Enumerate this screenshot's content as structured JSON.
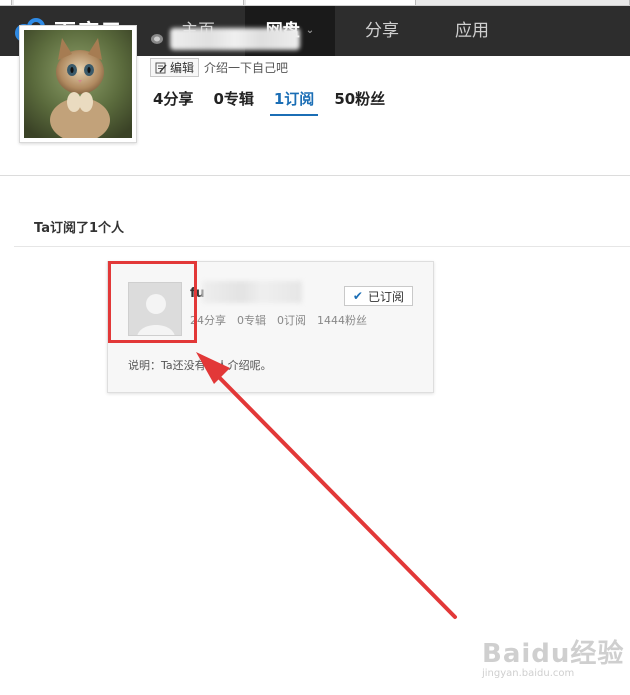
{
  "brand": {
    "logo_text": "百度云"
  },
  "nav": {
    "items": [
      {
        "label": "主页"
      },
      {
        "label": "网盘"
      },
      {
        "label": "分享"
      },
      {
        "label": "应用"
      }
    ]
  },
  "profile": {
    "edit_label": "编辑",
    "intro": "介绍一下自己吧",
    "stats": [
      {
        "label": "4分享"
      },
      {
        "label": "0专辑"
      },
      {
        "label": "1订阅"
      },
      {
        "label": "50粉丝"
      }
    ]
  },
  "section": {
    "title": "Ta订阅了1个人"
  },
  "card": {
    "name_initial": "fu",
    "subscribe_label": "已订阅",
    "stats": {
      "shares": "24分享",
      "albums": "0专辑",
      "subs": "0订阅",
      "fans": "1444粉丝"
    },
    "description": "说明：Ta还没有个人介绍呢。"
  },
  "watermark": {
    "main": "Baidu经验",
    "sub": "jingyan.baidu.com"
  },
  "colors": {
    "nav_bg": "#2d2d2d",
    "accent": "#1b6eb5",
    "annotation": "#e23838"
  }
}
